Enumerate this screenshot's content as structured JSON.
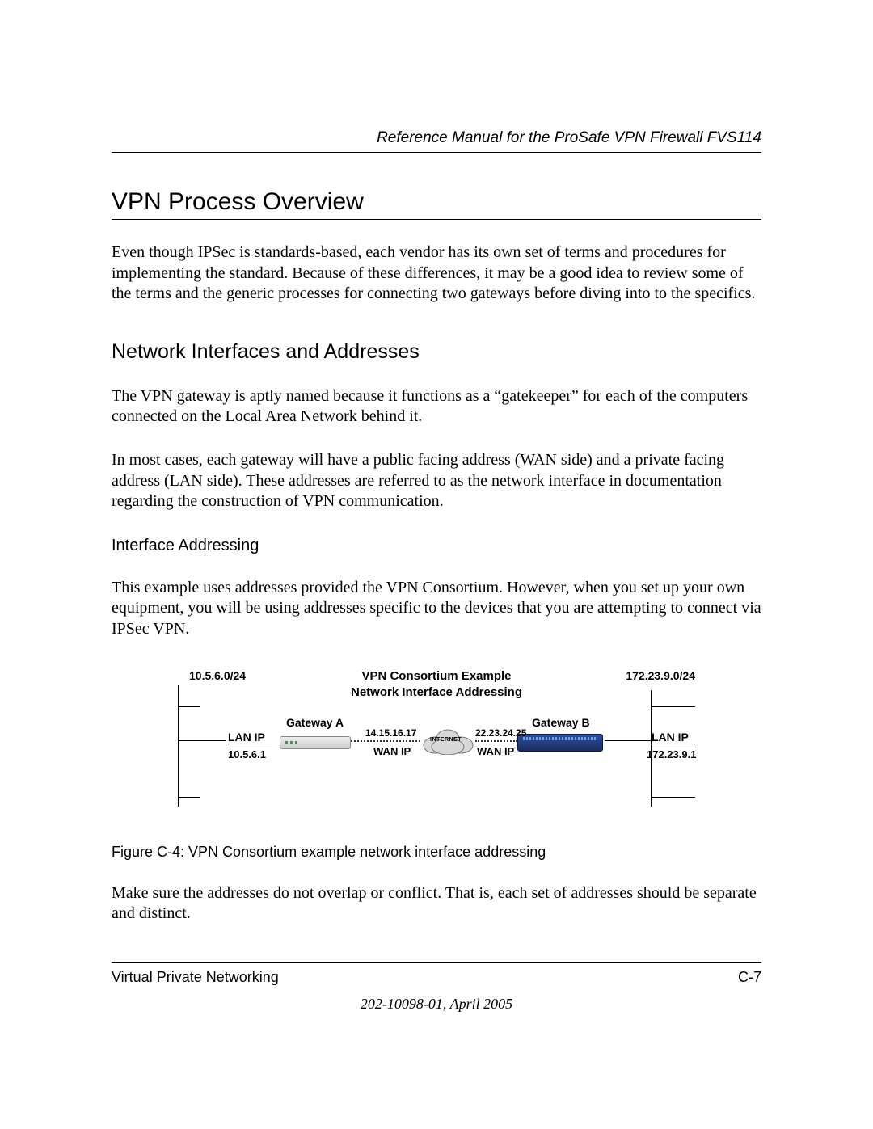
{
  "header": {
    "doc_title": "Reference Manual for the ProSafe VPN Firewall FVS114"
  },
  "section": {
    "title": "VPN Process Overview",
    "intro": "Even though IPSec is standards-based, each vendor has its own set of terms and procedures for implementing the standard. Because of these differences, it may be a good idea to review some of the terms and the generic processes for connecting two gateways before diving into to the specifics."
  },
  "subsection": {
    "title": "Network Interfaces and Addresses",
    "p1": "The VPN gateway is aptly named because it functions as a “gatekeeper” for each of the computers connected on the Local Area Network behind it.",
    "p2": "In most cases, each gateway will have a public facing address (WAN side) and a private facing address (LAN side). These addresses are referred to as the network interface in documentation regarding the construction of VPN communication."
  },
  "subsub": {
    "title": "Interface Addressing",
    "p1": "This example uses addresses provided the VPN Consortium. However, when you set up your own equipment, you will be using addresses specific to the devices that you are attempting to connect via IPSec VPN."
  },
  "diagram": {
    "title": "VPN Consortium Example",
    "subtitle": "Network Interface Addressing",
    "left_network": "10.5.6.0/24",
    "right_network": "172.23.9.0/24",
    "gateway_a_label": "Gateway A",
    "gateway_b_label": "Gateway B",
    "lan_ip_label": "LAN IP",
    "lan_ip_a": "10.5.6.1",
    "lan_ip_b": "172.23.9.1",
    "wan_ip_label": "WAN IP",
    "wan_ip_a": "14.15.16.17",
    "wan_ip_b": "22.23.24.25",
    "internet_label": "INTERNET"
  },
  "figure": {
    "caption": "Figure C-4:  VPN Consortium example network interface addressing"
  },
  "after_figure": "Make sure the addresses do not overlap or conflict. That is, each set of addresses should be separate and distinct.",
  "footer": {
    "section_name": "Virtual Private Networking",
    "page_number": "C-7",
    "doc_id": "202-10098-01, April 2005"
  }
}
